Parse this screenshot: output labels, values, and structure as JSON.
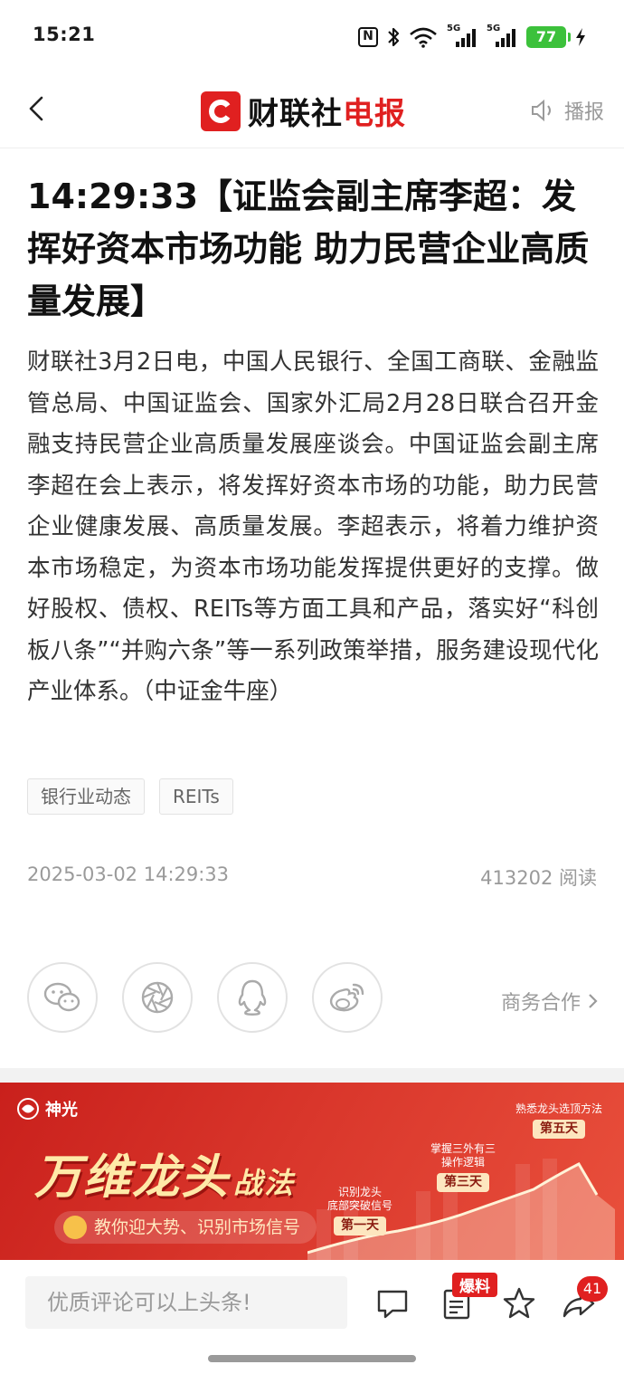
{
  "status_bar": {
    "time": "15:21",
    "nfc_label": "N",
    "signal_1_label": "5G",
    "signal_2_label": "5G",
    "battery": "77",
    "icons": [
      "nfc-icon",
      "bluetooth-icon",
      "wifi-icon",
      "signal-icon",
      "signal-icon",
      "battery-icon",
      "charging-icon"
    ]
  },
  "header": {
    "logo_plain": "财联社",
    "logo_red": "电报",
    "broadcast_label": "播报"
  },
  "article": {
    "title": "14:29:33【证监会副主席李超：发挥好资本市场功能 助力民营企业高质量发展】",
    "body": "财联社3月2日电，中国人民银行、全国工商联、金融监管总局、中国证监会、国家外汇局2月28日联合召开金融支持民营企业高质量发展座谈会。中国证监会副主席李超在会上表示，将发挥好资本市场的功能，助力民营企业健康发展、高质量发展。李超表示，将着力维护资本市场稳定，为资本市场功能发挥提供更好的支撑。做好股权、债权、REITs等方面工具和产品，落实好“科创板八条”“并购六条”等一系列政策举措，服务建设现代化产业体系。（中证金牛座）",
    "tags": [
      "银行业动态",
      "REITs"
    ],
    "datetime": "2025-03-02 14:29:33",
    "read_count": "413202 阅读"
  },
  "share": {
    "targets": [
      "wechat-icon",
      "moments-icon",
      "qq-icon",
      "weibo-icon"
    ],
    "business_link": "商务合作"
  },
  "banner": {
    "brand": "神光",
    "title_main": "万维龙头",
    "title_suffix": "战法",
    "subtitle": "教你迎大势、识别市场信号",
    "steps": [
      {
        "caption_1": "识别龙头",
        "caption_2": "底部突破信号",
        "label": "第一天"
      },
      {
        "caption_1": "掌握三外有三",
        "caption_2": "操作逻辑",
        "label": "第三天"
      },
      {
        "caption_1": "熟悉龙头选顶方法",
        "caption_2": "",
        "label": "第五天"
      }
    ]
  },
  "bottom_bar": {
    "comment_placeholder": "优质评论可以上头条!",
    "hot_badge": "爆料",
    "share_count": "41"
  },
  "colors": {
    "brand_red": "#e02020",
    "battery_green": "#3cc13b",
    "muted_text": "#9a9a9a"
  }
}
